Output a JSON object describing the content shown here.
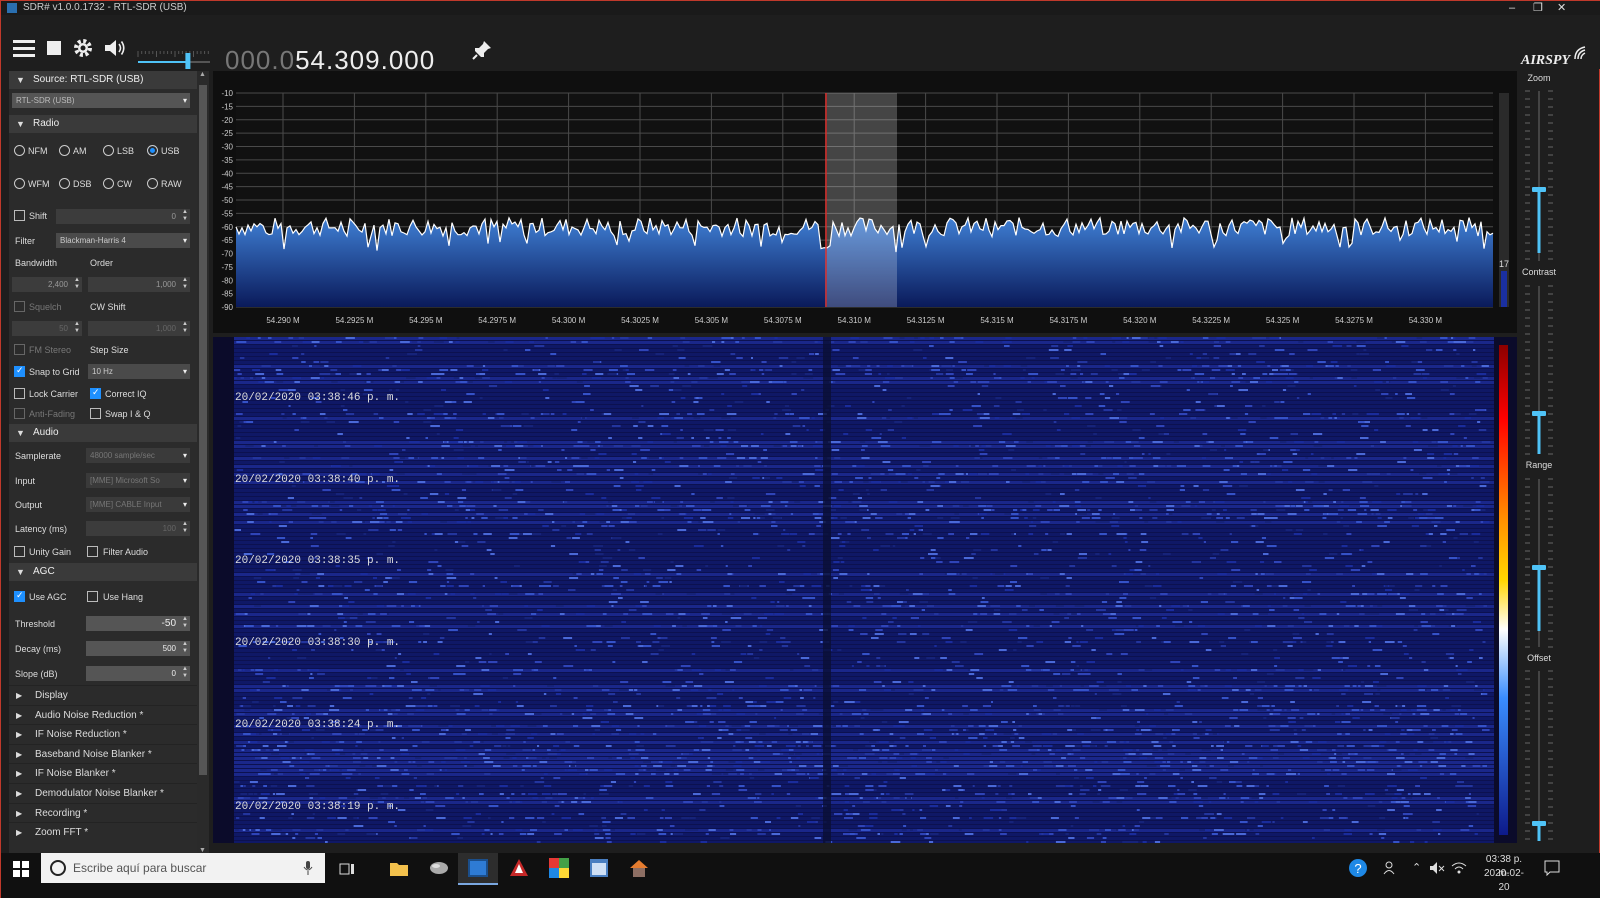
{
  "window": {
    "title": "SDR# v1.0.0.1732 - RTL-SDR (USB)",
    "minimize": "–",
    "maximize": "❐",
    "close": "✕"
  },
  "toolbar": {
    "menu_icon": "hamburger-icon",
    "stop_icon": "stop-icon",
    "settings_icon": "gear-icon",
    "speaker_icon": "speaker-icon",
    "pin_icon": "pin-icon",
    "freq_dim": "000.0",
    "freq_lit": "54.309.000",
    "brand": "AIRSPY",
    "volume": 0.7
  },
  "source": {
    "header": "Source: RTL-SDR (USB)",
    "device": "RTL-SDR (USB)"
  },
  "radio": {
    "header": "Radio",
    "modes": [
      {
        "label": "NFM",
        "selected": false
      },
      {
        "label": "AM",
        "selected": false
      },
      {
        "label": "LSB",
        "selected": false
      },
      {
        "label": "USB",
        "selected": true
      },
      {
        "label": "WFM",
        "selected": false
      },
      {
        "label": "DSB",
        "selected": false
      },
      {
        "label": "CW",
        "selected": false
      },
      {
        "label": "RAW",
        "selected": false
      }
    ],
    "shift_label": "Shift",
    "shift_value": "0",
    "filter_label": "Filter",
    "filter_value": "Blackman-Harris 4",
    "bandwidth_label": "Bandwidth",
    "order_label": "Order",
    "bandwidth_value": "2,400",
    "order_value": "1,000",
    "squelch_label": "Squelch",
    "cwshift_label": "CW Shift",
    "squelch_value": "50",
    "cwshift_value": "1,000",
    "fmstereo_label": "FM Stereo",
    "stepsize_label": "Step Size",
    "snap_label": "Snap to Grid",
    "step_value": "10 Hz",
    "lock_label": "Lock Carrier",
    "correctiq_label": "Correct IQ",
    "antifading_label": "Anti-Fading",
    "swapiq_label": "Swap I & Q"
  },
  "audio": {
    "header": "Audio",
    "samplerate_label": "Samplerate",
    "samplerate_value": "48000 sample/sec",
    "input_label": "Input",
    "input_value": "[MME] Microsoft So",
    "output_label": "Output",
    "output_value": "[MME] CABLE Input",
    "latency_label": "Latency (ms)",
    "latency_value": "100",
    "unity_label": "Unity Gain",
    "filteraudio_label": "Filter Audio"
  },
  "agc": {
    "header": "AGC",
    "useagc_label": "Use AGC",
    "usehang_label": "Use Hang",
    "threshold_label": "Threshold",
    "threshold_value": "-50",
    "decay_label": "Decay (ms)",
    "decay_value": "500",
    "slope_label": "Slope (dB)",
    "slope_value": "0"
  },
  "collapsed_sections": [
    "Display",
    "Audio Noise Reduction *",
    "IF Noise Reduction *",
    "Baseband Noise Blanker *",
    "IF Noise Blanker *",
    "Demodulator Noise Blanker *",
    "Recording *",
    "Zoom FFT *"
  ],
  "spectrum": {
    "db_labels": [
      "-10",
      "-15",
      "-20",
      "-25",
      "-30",
      "-35",
      "-40",
      "-45",
      "-50",
      "-55",
      "-60",
      "-65",
      "-70",
      "-75",
      "-80",
      "-85",
      "-90"
    ],
    "freq_labels": [
      "54.290 M",
      "54.2925 M",
      "54.295 M",
      "54.2975 M",
      "54.300 M",
      "54.3025 M",
      "54.305 M",
      "54.3075 M",
      "54.310 M",
      "54.3125 M",
      "54.315 M",
      "54.3175 M",
      "54.320 M",
      "54.3225 M",
      "54.325 M",
      "54.3275 M",
      "54.330 M"
    ],
    "side_value": "17",
    "baseline_db": -60
  },
  "waterfall": {
    "timestamps": [
      "20/02/2020 03:38:46 p. m.",
      "20/02/2020 03:38:40 p. m.",
      "20/02/2020 03:38:35 p. m.",
      "20/02/2020 03:38:30 p. m.",
      "20/02/2020 03:38:24 p. m.",
      "20/02/2020 03:38:19 p. m."
    ]
  },
  "rightpanel": {
    "zoom": "Zoom",
    "contrast": "Contrast",
    "range": "Range",
    "offset": "Offset"
  },
  "taskbar": {
    "search_placeholder": "Escribe aquí para buscar",
    "time": "03:38 p. m.",
    "date": "2020-02-20",
    "colors": {
      "bar": "#101010",
      "accent": "#1e90ff"
    }
  }
}
